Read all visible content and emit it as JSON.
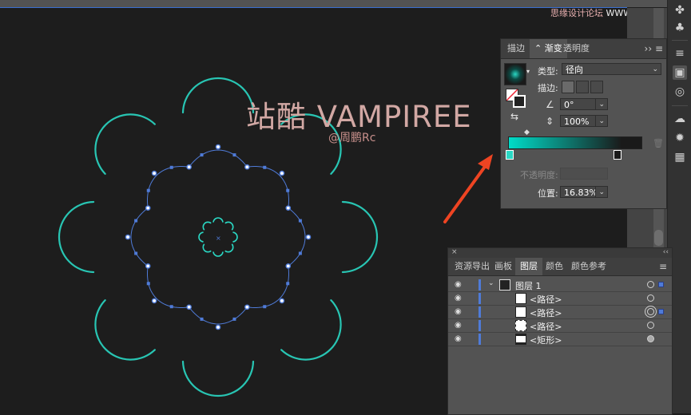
{
  "watermark": {
    "title": "站酷 VAMPIREE",
    "handle": "@周鹏Rc",
    "site_cn": "思缘设计论坛",
    "site_url": "WWW.MISSVUAN.COM"
  },
  "gradient_panel": {
    "tabs": [
      {
        "label": "描边",
        "active": false
      },
      {
        "label": "渐变",
        "active": true
      },
      {
        "label": "透明度",
        "active": false
      }
    ],
    "menu_icons": "›› ≡",
    "type_label": "类型:",
    "type_value": "径向",
    "stroke_label": "描边:",
    "angle_value": "0°",
    "aspect_value": "100%",
    "opacity_label": "不透明度:",
    "position_label": "位置:",
    "position_value": "16.83%",
    "gradient_start_color": "#00dcc8",
    "gradient_end_color": "#1a1a1a"
  },
  "layers_panel": {
    "tabs": [
      {
        "label": "资源导出",
        "active": false
      },
      {
        "label": "画板",
        "active": false
      },
      {
        "label": "图层",
        "active": true
      },
      {
        "label": "颜色",
        "active": false
      },
      {
        "label": "颜色参考",
        "active": false
      }
    ],
    "rows": [
      {
        "name": "图层 1"
      },
      {
        "name": "<路径>"
      },
      {
        "name": "<路径>"
      },
      {
        "name": "<路径>"
      },
      {
        "name": "<矩形>"
      }
    ]
  },
  "colors": {
    "accent_teal": "#2ad8c4",
    "selection_blue": "#4f7bd8",
    "arrow_red": "#ee4422"
  },
  "tools": [
    "club-icon",
    "menu-icon",
    "gradient-icon",
    "transparency-icon",
    "cc-libraries-icon",
    "sun-icon",
    "align-icon"
  ]
}
